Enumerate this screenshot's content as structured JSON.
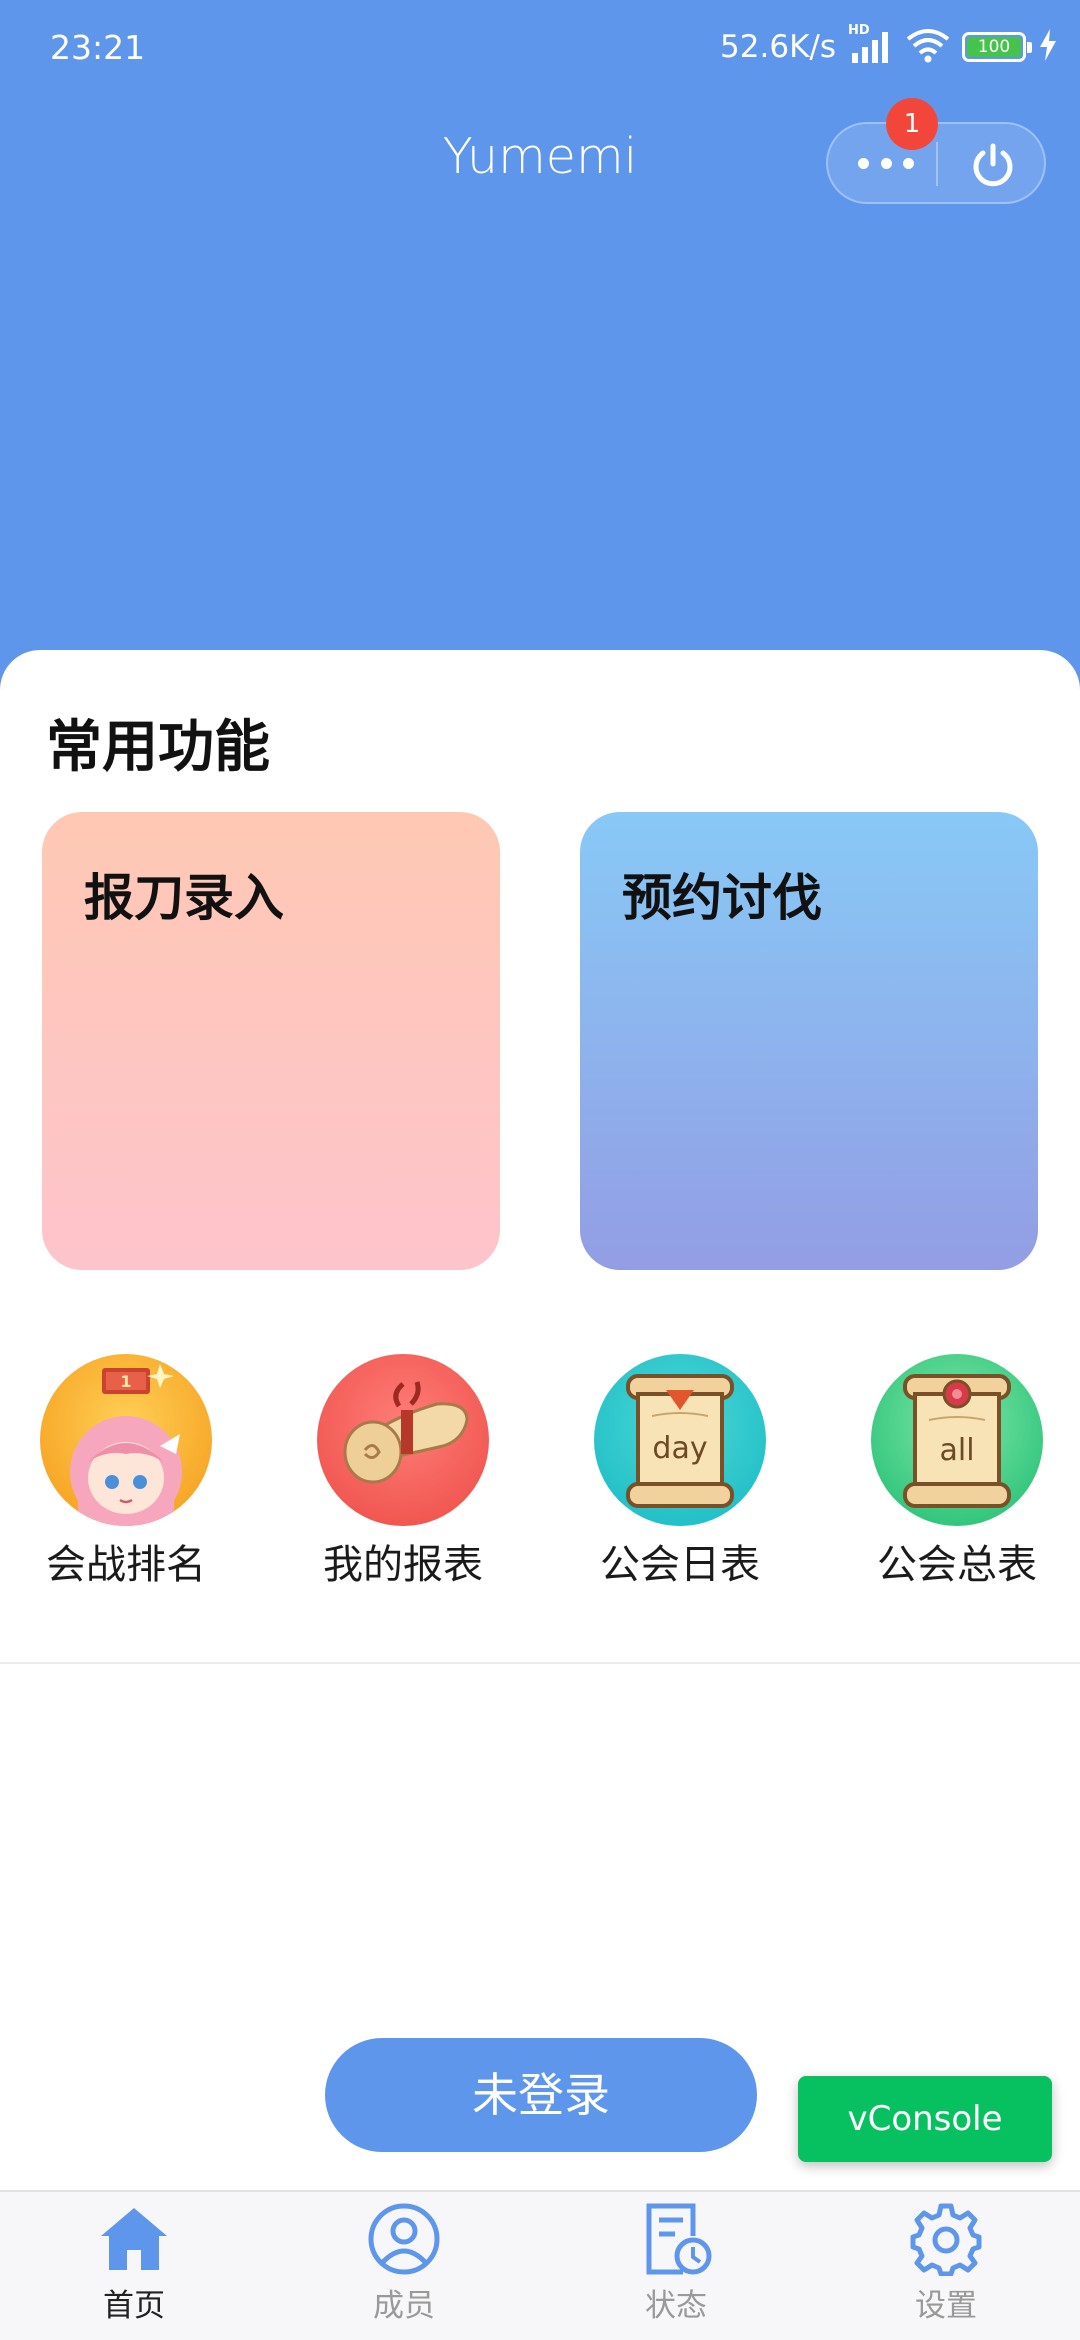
{
  "status_bar": {
    "time": "23:21",
    "net_speed": "52.6K/s",
    "signal_tag": "HD",
    "battery": "100"
  },
  "navbar": {
    "title": "Yumemi",
    "badge_count": "1"
  },
  "main": {
    "section_title": "常用功能",
    "feature_cards": [
      {
        "label": "报刀录入"
      },
      {
        "label": "预约讨伐"
      }
    ],
    "shortcuts": [
      {
        "label": "会战排名",
        "icon": "rank-avatar-icon"
      },
      {
        "label": "我的报表",
        "icon": "scroll-icon"
      },
      {
        "label": "公会日表",
        "icon": "day-scroll-icon",
        "icon_text": "day"
      },
      {
        "label": "公会总表",
        "icon": "all-scroll-icon",
        "icon_text": "all"
      }
    ],
    "login_button": "未登录"
  },
  "vconsole": "vConsole",
  "tabbar": {
    "items": [
      {
        "label": "首页",
        "icon": "home-icon",
        "active": true
      },
      {
        "label": "成员",
        "icon": "user-icon",
        "active": false
      },
      {
        "label": "状态",
        "icon": "status-clock-icon",
        "active": false
      },
      {
        "label": "设置",
        "icon": "gear-icon",
        "active": false
      }
    ]
  },
  "colors": {
    "primary": "#5e96ec",
    "badge": "#f2463a",
    "vconsole": "#07c160"
  }
}
